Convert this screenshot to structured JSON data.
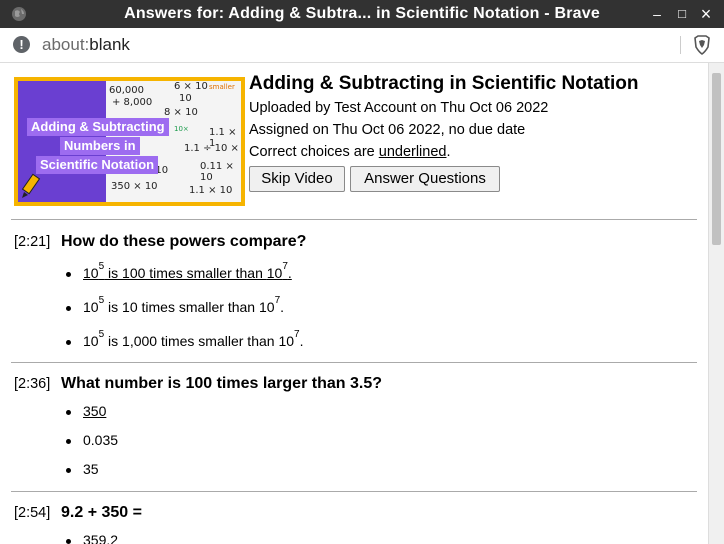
{
  "window": {
    "title": "Answers for: Adding & Subtra... in Scientific Notation - Brave",
    "minimize_label": "–",
    "maximize_label": "□",
    "close_label": "×"
  },
  "address_bar": {
    "url_scheme": "about:",
    "url_path": "blank"
  },
  "video": {
    "title": "Adding & Subtracting in Scientific Notation",
    "uploaded": "Uploaded by Test Account on Thu Oct 06 2022",
    "assigned": "Assigned on Thu Oct 06 2022, no due date",
    "correct_prefix": "Correct choices are ",
    "correct_word": "underlined",
    "correct_suffix": ".",
    "thumbnail": {
      "line1": "Adding & Subtracting",
      "line2": "Numbers in",
      "line3": "Scientific Notation",
      "math": [
        "60,000",
        "+ 8,000",
        "6 × 10",
        "10",
        "8 × 10",
        "1.1 × 1",
        "1.1 ÷ 10 ×",
        "0.11 × 10",
        "× 100 × 10",
        "350 × 10",
        "1.1 × 10",
        "smaller",
        "10×"
      ]
    },
    "buttons": {
      "skip": "Skip Video",
      "answer": "Answer Questions"
    }
  },
  "questions": [
    {
      "time": "[2:21]",
      "text": "How do these powers compare?",
      "answers": [
        {
          "base1": "10",
          "exp1": "5",
          "mid": " is 100 times smaller than ",
          "base2": "10",
          "exp2": "7",
          "end": "."
        },
        {
          "base1": "10",
          "exp1": "5",
          "mid": " is 10 times smaller than ",
          "base2": "10",
          "exp2": "7",
          "end": "."
        },
        {
          "base1": "10",
          "exp1": "5",
          "mid": " is 1,000 times smaller than ",
          "base2": "10",
          "exp2": "7",
          "end": "."
        }
      ]
    },
    {
      "time": "[2:36]",
      "text": "What number is 100 times larger than 3.5?",
      "answers": [
        "350",
        "0.035",
        "35"
      ]
    },
    {
      "time": "[2:54]",
      "text": "9.2 + 350 =",
      "answers": [
        "359.2"
      ]
    }
  ]
}
